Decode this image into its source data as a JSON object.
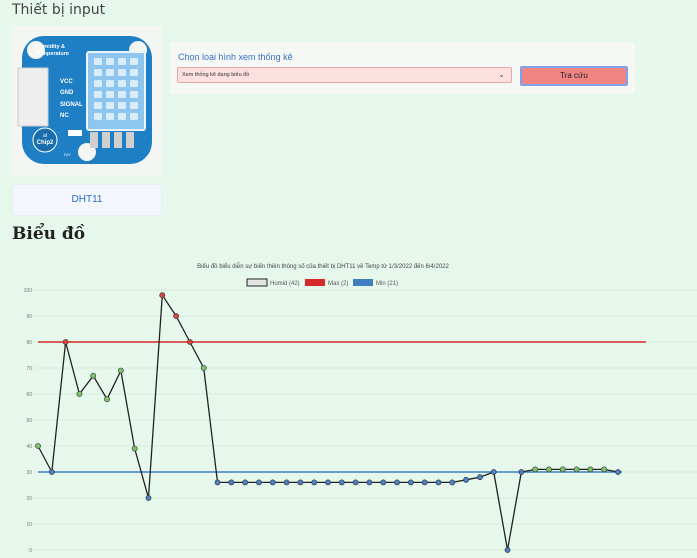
{
  "input_section": {
    "title": "Thiết bị input"
  },
  "device": {
    "caption": "DHT11",
    "board_title_line1": "Humidity &",
    "board_title_line2": "Temperature",
    "pins": [
      "VCC",
      "GND",
      "SIGNAL",
      "NC"
    ],
    "logo_line1": "al",
    "logo_line2": "Chip2",
    "logo_mark": "DIY",
    "board_color": "#1f7fc4",
    "sensor_color": "#8ec5ee"
  },
  "stats_panel": {
    "label": "Chọn loại hình xem thống kê",
    "select_value": "Xem thống kê dạng biểu đồ",
    "button_label": "Tra cứu"
  },
  "chart_section": {
    "heading": "Biểu đồ"
  },
  "chart_data": {
    "type": "line",
    "title": "Biểu đồ biểu diễn sự biến thiên thông số của thiết bị DHT11 về Temp từ 1/3/2022 đến 6/4/2022",
    "legend_position": "top",
    "grid": true,
    "yticks": [
      0,
      10,
      20,
      30,
      40,
      50,
      60,
      70,
      80,
      90,
      100
    ],
    "ylim": [
      0,
      100
    ],
    "series": [
      {
        "name": "Humid (42)",
        "color": "#222222",
        "values": [
          40,
          30,
          80,
          60,
          67,
          58,
          69,
          39,
          20,
          98,
          90,
          80,
          70,
          26,
          26,
          26,
          26,
          26,
          26,
          26,
          26,
          26,
          26,
          26,
          26,
          26,
          26,
          26,
          26,
          26,
          26,
          27,
          28,
          30,
          0,
          30,
          31,
          31,
          31,
          31,
          31,
          31,
          30
        ]
      },
      {
        "name": "Max (2)",
        "color": "#d42a2a",
        "values": [
          80,
          80
        ]
      },
      {
        "name": "Min (21)",
        "color": "#3f7fc0",
        "values": [
          30,
          30
        ]
      }
    ],
    "point_colors": {
      "max": "#d84444",
      "min": "#4a7fc0",
      "normal": "#7bc46a"
    }
  }
}
